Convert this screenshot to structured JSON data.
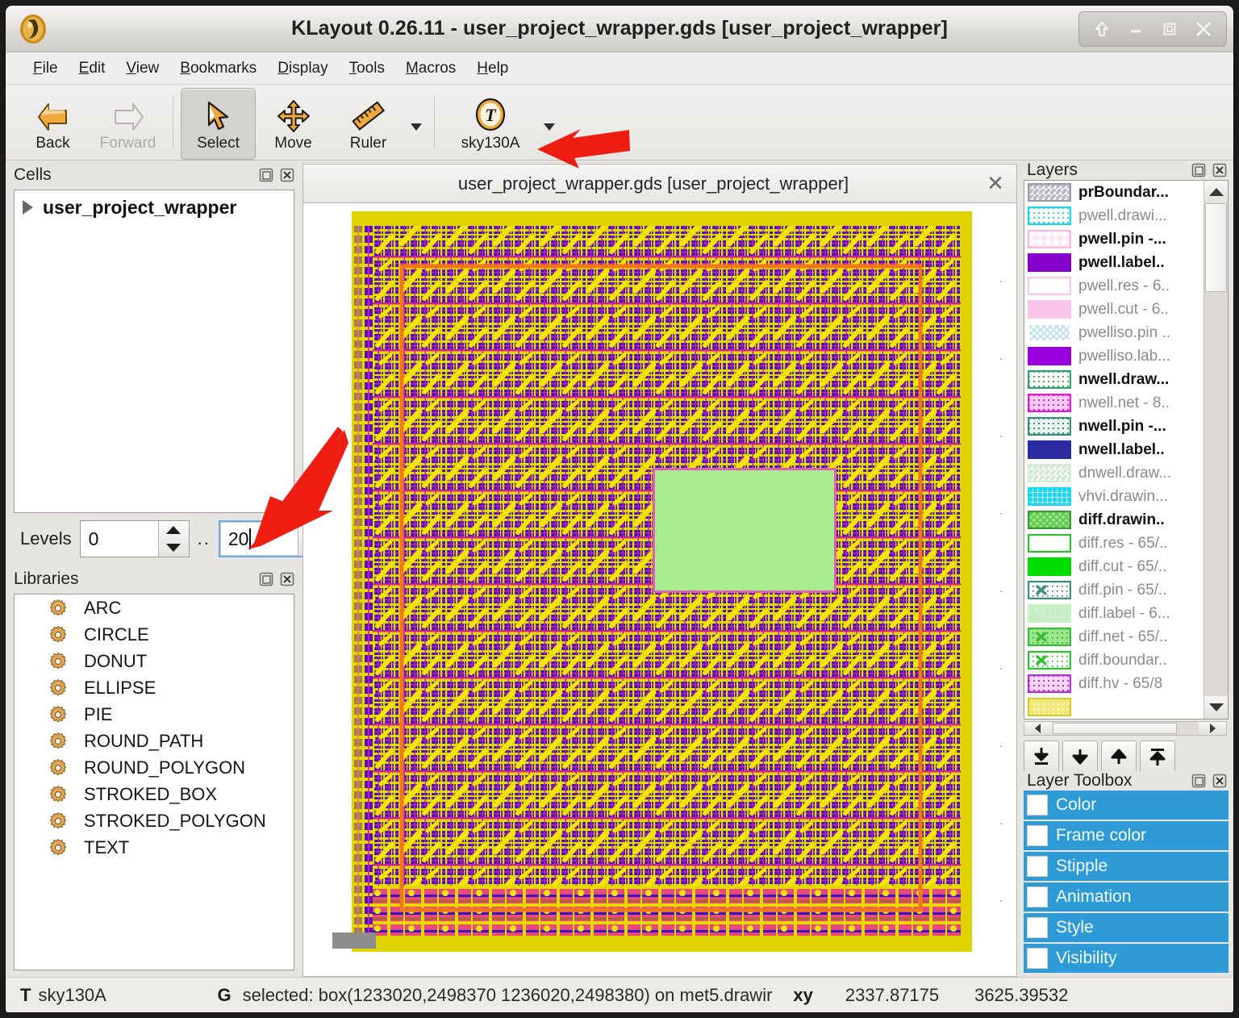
{
  "window": {
    "title": "KLayout 0.26.11 - user_project_wrapper.gds [user_project_wrapper]",
    "logo_icon": "klayout-logo-icon",
    "buttons": [
      {
        "name": "shade-button",
        "icon": "up-arrow-icon"
      },
      {
        "name": "minimize-button",
        "icon": "minimize-icon"
      },
      {
        "name": "maximize-button",
        "icon": "maximize-icon"
      },
      {
        "name": "close-button",
        "icon": "close-icon"
      }
    ]
  },
  "menubar": [
    {
      "label": "File",
      "mnemonic": "F"
    },
    {
      "label": "Edit",
      "mnemonic": "E"
    },
    {
      "label": "View",
      "mnemonic": "V"
    },
    {
      "label": "Bookmarks",
      "mnemonic": "B"
    },
    {
      "label": "Display",
      "mnemonic": "D"
    },
    {
      "label": "Tools",
      "mnemonic": "T"
    },
    {
      "label": "Macros",
      "mnemonic": "M"
    },
    {
      "label": "Help",
      "mnemonic": "H"
    }
  ],
  "toolbar": [
    {
      "label": "Back",
      "icon": "back-arrow-icon",
      "enabled": true,
      "active": false,
      "dropdown": false
    },
    {
      "label": "Forward",
      "icon": "forward-arrow-icon",
      "enabled": false,
      "active": false,
      "dropdown": false
    },
    {
      "label": "Select",
      "icon": "cursor-arrow-icon",
      "enabled": true,
      "active": true,
      "dropdown": false
    },
    {
      "label": "Move",
      "icon": "move-cross-icon",
      "enabled": true,
      "active": false,
      "dropdown": false
    },
    {
      "label": "Ruler",
      "icon": "ruler-icon",
      "enabled": true,
      "active": false,
      "dropdown": true
    },
    {
      "label": "sky130A",
      "icon": "technology-t-icon",
      "enabled": true,
      "active": false,
      "dropdown": true
    }
  ],
  "cells": {
    "title": "Cells",
    "dock_icon": "undock-icon",
    "close_icon": "close-icon",
    "items": [
      {
        "label": "user_project_wrapper",
        "expander": "triangle-right-icon",
        "bold": true
      }
    ]
  },
  "levels": {
    "label": "Levels",
    "min_value": "0",
    "separator": "..",
    "max_value": "20",
    "max_focused": true
  },
  "libraries": {
    "title": "Libraries",
    "dock_icon": "undock-icon",
    "close_icon": "close-icon",
    "items": [
      {
        "label": "ARC",
        "icon": "gear-icon"
      },
      {
        "label": "CIRCLE",
        "icon": "gear-icon"
      },
      {
        "label": "DONUT",
        "icon": "gear-icon"
      },
      {
        "label": "ELLIPSE",
        "icon": "gear-icon"
      },
      {
        "label": "PIE",
        "icon": "gear-icon"
      },
      {
        "label": "ROUND_PATH",
        "icon": "gear-icon"
      },
      {
        "label": "ROUND_POLYGON",
        "icon": "gear-icon"
      },
      {
        "label": "STROKED_BOX",
        "icon": "gear-icon"
      },
      {
        "label": "STROKED_POLYGON",
        "icon": "gear-icon"
      },
      {
        "label": "TEXT",
        "icon": "gear-icon"
      }
    ]
  },
  "canvas": {
    "tab_label": "user_project_wrapper.gds [user_project_wrapper]",
    "tab_close_icon": "close-icon",
    "background": "#ffffff",
    "layout_colors": {
      "metal_yellow": "#e8d800",
      "metal_blue": "#2a18c8",
      "metal_magenta": "#e81ec8",
      "boundary_orange": "#f07818",
      "macro_green": "#a8ec8f",
      "macro_border": "#e060b0",
      "selection_gray": "#8d8d8d"
    }
  },
  "layers": {
    "title": "Layers",
    "dock_icon": "undock-icon",
    "close_icon": "close-icon",
    "items": [
      {
        "label": "prBoundar...",
        "visible": true,
        "fill": "#ffffff",
        "frame": "#9a9aa8",
        "pattern": "diag",
        "pcolor": "#b8b8c4"
      },
      {
        "label": "pwell.drawi...",
        "visible": false,
        "fill": "#ffffff",
        "frame": "#19d7e8",
        "pattern": "dots",
        "pcolor": "#19d7e8"
      },
      {
        "label": "pwell.pin -...",
        "visible": true,
        "fill": "#ffe4f4",
        "frame": "#f7b8e0",
        "pattern": "diamond",
        "pcolor": "#ffffff"
      },
      {
        "label": "pwell.label..",
        "visible": true,
        "fill": "#8800cc",
        "frame": "#8800cc",
        "pattern": "solid",
        "pcolor": "#8800cc"
      },
      {
        "label": "pwell.res - 6..",
        "visible": false,
        "fill": "#ffffff",
        "frame": "#f2c8e4",
        "pattern": "solid",
        "pcolor": "#ffffff"
      },
      {
        "label": "pwell.cut - 6..",
        "visible": false,
        "fill": "#f8c4ea",
        "frame": "#f8c4ea",
        "pattern": "solid",
        "pcolor": "#f8c4ea"
      },
      {
        "label": "pwelliso.pin ..",
        "visible": false,
        "fill": "#ffffff",
        "frame": "#ffffff",
        "pattern": "cross",
        "pcolor": "#b8dcf0"
      },
      {
        "label": "pwelliso.lab...",
        "visible": false,
        "fill": "#9900dd",
        "frame": "#9900dd",
        "pattern": "solid",
        "pcolor": "#9900dd"
      },
      {
        "label": "nwell.draw...",
        "visible": true,
        "fill": "#ffffff",
        "frame": "#2e9e7a",
        "pattern": "dots",
        "pcolor": "#4caf50"
      },
      {
        "label": "nwell.net - 8..",
        "visible": false,
        "fill": "#ffccf7",
        "frame": "#e21ad4",
        "pattern": "dots",
        "pcolor": "#e21ad4"
      },
      {
        "label": "nwell.pin -...",
        "visible": true,
        "fill": "#eaf7ef",
        "frame": "#3a8f7a",
        "pattern": "dots",
        "pcolor": "#3a8f7a"
      },
      {
        "label": "nwell.label..",
        "visible": true,
        "fill": "#2a2aa0",
        "frame": "#2a2aa0",
        "pattern": "solid",
        "pcolor": "#2a2aa0"
      },
      {
        "label": "dnwell.draw...",
        "visible": false,
        "fill": "#ffffff",
        "frame": "#d8ecd8",
        "pattern": "diag",
        "pcolor": "#cfe8cf"
      },
      {
        "label": "vhvi.drawin...",
        "visible": false,
        "fill": "#19d7f0",
        "frame": "#19d7f0",
        "pattern": "grid",
        "pcolor": "#ffffff"
      },
      {
        "label": "diff.drawin..",
        "visible": true,
        "fill": "#8fe878",
        "frame": "#3a9a3a",
        "pattern": "cross",
        "pcolor": "#5fbf4f"
      },
      {
        "label": "diff.res - 65/..",
        "visible": false,
        "fill": "#ffffff",
        "frame": "#2ec12e",
        "pattern": "solid",
        "pcolor": "#ffffff"
      },
      {
        "label": "diff.cut - 65/..",
        "visible": false,
        "fill": "#00dd00",
        "frame": "#00dd00",
        "pattern": "solid",
        "pcolor": "#00dd00"
      },
      {
        "label": "diff.pin - 65/..",
        "visible": false,
        "fill": "#ffffff",
        "frame": "#3a8f7a",
        "pattern": "x",
        "pcolor": "#2b6b5c"
      },
      {
        "label": "diff.label - 6...",
        "visible": false,
        "fill": "#c8f0c8",
        "frame": "#c8f0c8",
        "pattern": "x",
        "pcolor": "#a8dfa8"
      },
      {
        "label": "diff.net - 65/..",
        "visible": false,
        "fill": "#9ae88a",
        "frame": "#3aba3a",
        "pattern": "x",
        "pcolor": "#2f9a2f"
      },
      {
        "label": "diff.boundar..",
        "visible": false,
        "fill": "#ffffff",
        "frame": "#2ec12e",
        "pattern": "x",
        "pcolor": "#00cc00"
      },
      {
        "label": "diff.hv - 65/8",
        "visible": false,
        "fill": "#ffd8ff",
        "frame": "#b32ed6",
        "pattern": "dots",
        "pcolor": "#c42ee0"
      },
      {
        "label": "",
        "visible": true,
        "fill": "#f2e87a",
        "frame": "#d8c820",
        "pattern": "dots",
        "pcolor": "#ffffff"
      }
    ],
    "move_buttons": [
      {
        "name": "move-to-bottom-button",
        "icon": "arrow-to-bottom-icon"
      },
      {
        "name": "move-down-button",
        "icon": "arrow-down-icon"
      },
      {
        "name": "move-up-button",
        "icon": "arrow-up-icon"
      },
      {
        "name": "move-to-top-button",
        "icon": "arrow-to-top-icon"
      }
    ]
  },
  "layer_toolbox": {
    "title": "Layer Toolbox",
    "dock_icon": "undock-icon",
    "close_icon": "close-icon",
    "accent": "#2e9bd6",
    "items": [
      {
        "label": "Color",
        "checked": false
      },
      {
        "label": "Frame color",
        "checked": false
      },
      {
        "label": "Stipple",
        "checked": false
      },
      {
        "label": "Animation",
        "checked": false
      },
      {
        "label": "Style",
        "checked": false
      },
      {
        "label": "Visibility",
        "checked": false
      }
    ]
  },
  "statusbar": {
    "tech_key": "T",
    "tech_value": "sky130A",
    "mode_key": "G",
    "mode_value": "selected: box(1233020,2498370 1236020,2498380) on met5.drawir",
    "xy_key": "xy",
    "x_value": "2337.87175",
    "y_value": "3625.39532"
  },
  "annotations": {
    "arrow_color": "#ee1c11",
    "arrows": [
      {
        "name": "arrow-pointing-to-technology-selector",
        "target": "sky130A toolbar button"
      },
      {
        "name": "arrow-pointing-to-levels-max-field",
        "target": "Levels max spinbox"
      }
    ]
  }
}
